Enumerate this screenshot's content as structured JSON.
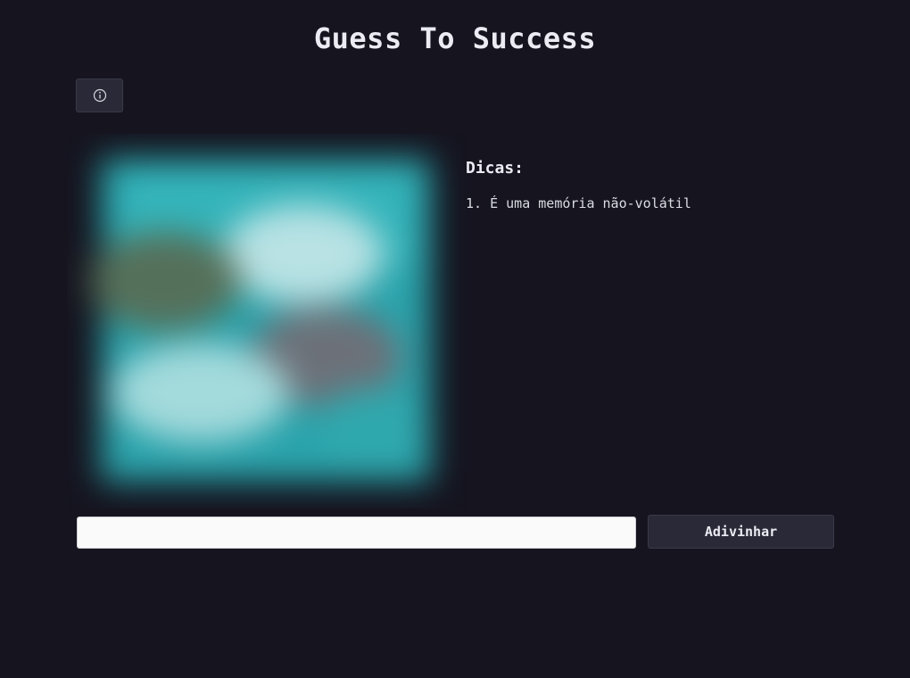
{
  "header": {
    "title": "Guess To Success"
  },
  "toolbar": {
    "info_icon": "info-icon"
  },
  "image": {
    "description_colors": {
      "cyan": "#2fb6bd",
      "light": "#bfe8ea",
      "olive": "#5f6e55",
      "gray": "#6b7078"
    }
  },
  "hints": {
    "title": "Dicas:",
    "items": [
      "1. É uma memória não-volátil"
    ]
  },
  "guess": {
    "input_value": "",
    "input_placeholder": "",
    "button_label": "Adivinhar"
  }
}
